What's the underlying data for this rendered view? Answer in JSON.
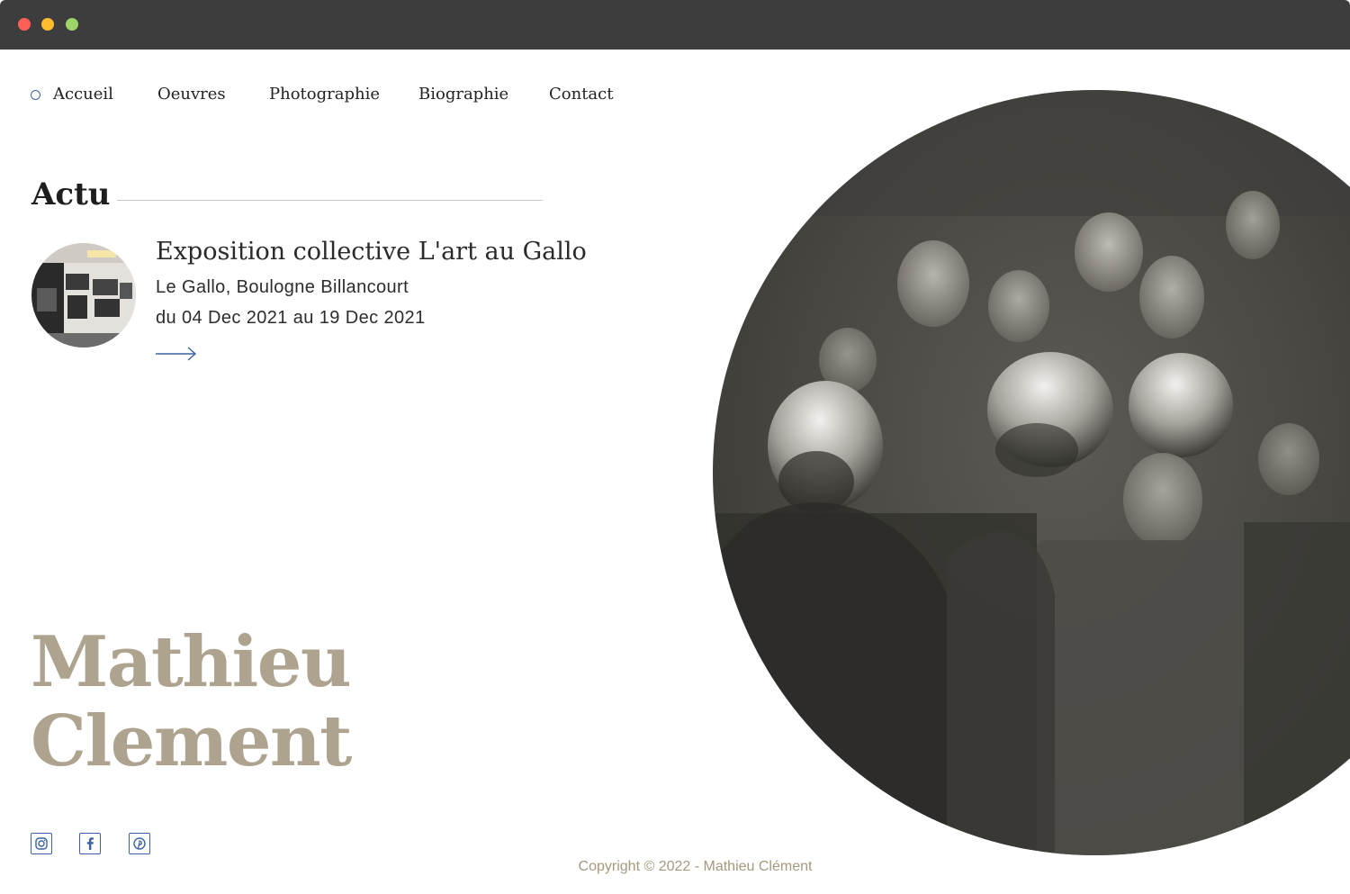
{
  "nav": {
    "items": [
      {
        "label": "Accueil",
        "active": true
      },
      {
        "label": "Oeuvres"
      },
      {
        "label": "Photographie"
      },
      {
        "label": "Biographie"
      },
      {
        "label": "Contact"
      }
    ]
  },
  "actu": {
    "heading": "Actu",
    "news": {
      "title": "Exposition collective L'art au Gallo",
      "place": "Le Gallo, Boulogne Billancourt",
      "dates": "du 04 Dec 2021 au 19 Dec 2021"
    }
  },
  "artist": {
    "first_name": "Mathieu",
    "last_name": "Clement"
  },
  "social": [
    "instagram-icon",
    "facebook-icon",
    "pinterest-icon"
  ],
  "footer": {
    "copyright": "Copyright © 2022 - Mathieu Clément"
  },
  "colors": {
    "accent": "#3a63a3",
    "name": "#ada38e",
    "copyright": "#a6997e",
    "titlebar": "#3d3d3d"
  }
}
